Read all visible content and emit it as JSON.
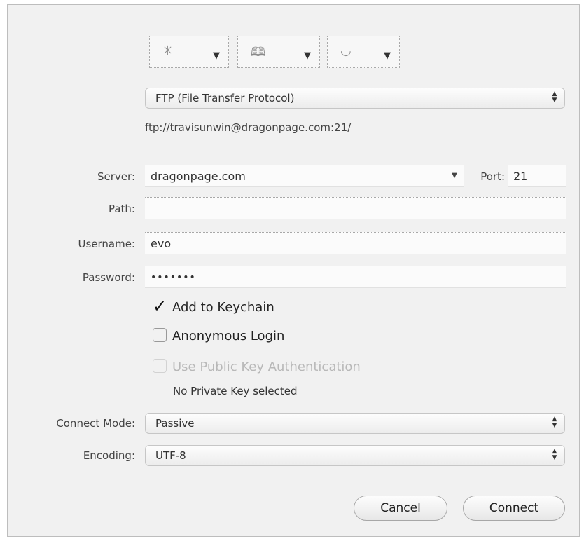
{
  "toolbar": {
    "buttons": [
      {
        "icon": "bonjour-icon",
        "glyph": "✳"
      },
      {
        "icon": "bookmarks-icon",
        "glyph": "🕮"
      },
      {
        "icon": "history-icon",
        "glyph": "◡"
      }
    ],
    "arrow": "▼"
  },
  "protocol": {
    "selected": "FTP (File Transfer Protocol)",
    "url": "ftp://travisunwin@dragonpage.com:21/"
  },
  "form": {
    "server_label": "Server:",
    "server_value": "dragonpage.com",
    "port_label": "Port:",
    "port_value": "21",
    "path_label": "Path:",
    "path_value": "",
    "username_label": "Username:",
    "username_value": "evo",
    "password_label": "Password:",
    "password_value": "•••••••"
  },
  "options": {
    "keychain_label": "Add to Keychain",
    "keychain_checked": true,
    "anonymous_label": "Anonymous Login",
    "anonymous_checked": false,
    "publickey_label": "Use Public Key Authentication",
    "publickey_enabled": false,
    "private_key_status": "No Private Key selected"
  },
  "connect_mode": {
    "label": "Connect Mode:",
    "selected": "Passive"
  },
  "encoding": {
    "label": "Encoding:",
    "selected": "UTF-8"
  },
  "buttons": {
    "cancel": "Cancel",
    "connect": "Connect"
  }
}
